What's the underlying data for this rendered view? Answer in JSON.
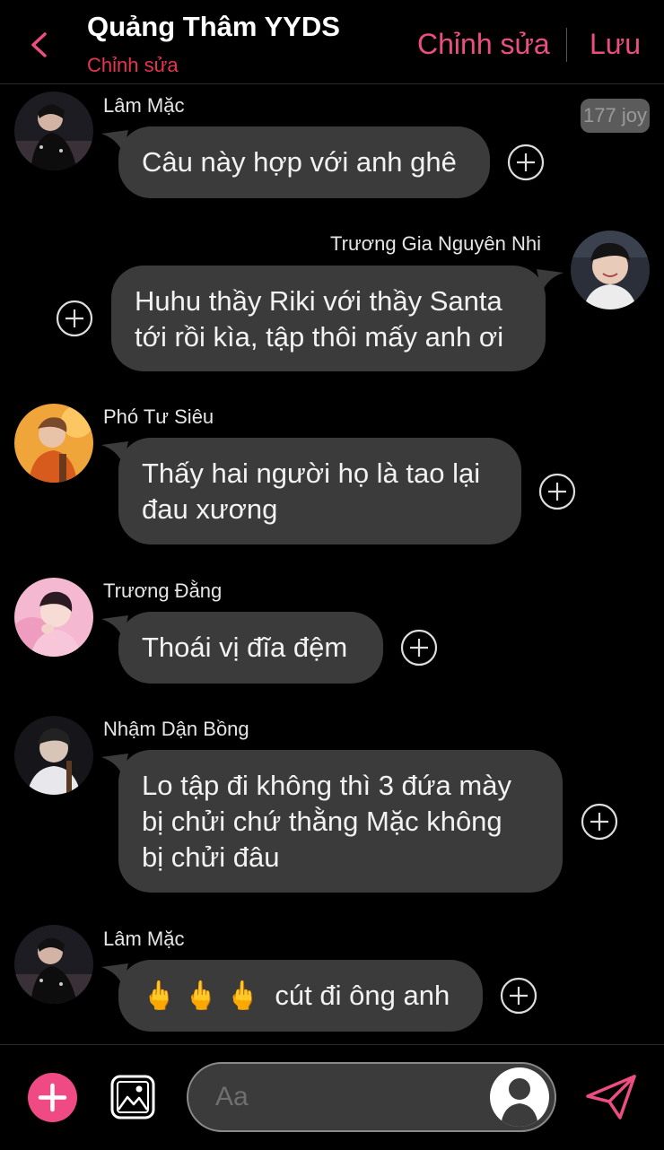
{
  "header": {
    "title": "Quảng Thâm YYDS",
    "subtitle": "Chỉnh sửa",
    "edit_label": "Chỉnh sửa",
    "save_label": "Lưu"
  },
  "joy_badge": "177 joy",
  "messages": [
    {
      "sender": "Lâm Mặc",
      "text": "Câu này hợp với anh ghê",
      "side": "left"
    },
    {
      "sender": "Trương Gia Nguyên Nhi",
      "lines": [
        "Huhu thầy Riki với thầy Santa",
        "tới rồi kìa, tập thôi mấy anh ơi"
      ],
      "side": "right"
    },
    {
      "sender": "Phó Tư Siêu",
      "lines": [
        "Thấy hai người họ là tao lại",
        "đau xương"
      ],
      "side": "left"
    },
    {
      "sender": "Trương Đằng",
      "text": "Thoái vị đĩa đệm",
      "side": "left"
    },
    {
      "sender": "Nhậm Dận Bồng",
      "lines": [
        "Lo tập đi không thì 3 đứa mày",
        "bị chửi chứ thằng Mặc không",
        "bị chửi đâu"
      ],
      "side": "left"
    },
    {
      "sender": "Lâm Mặc",
      "emoji": "🖕🖕🖕",
      "text": "cút đi ông anh",
      "side": "left"
    }
  ],
  "composer": {
    "placeholder": "Aa"
  },
  "colors": {
    "accent": "#ec4d82",
    "subtitle": "#e8344f",
    "bubble": "#3b3b3b",
    "background": "#000000"
  },
  "icons": {
    "back": "chevron-left-icon",
    "add_reaction": "plus-circle-icon",
    "add": "plus-icon",
    "image": "image-icon",
    "user": "user-silhouette-icon",
    "send": "send-icon"
  }
}
